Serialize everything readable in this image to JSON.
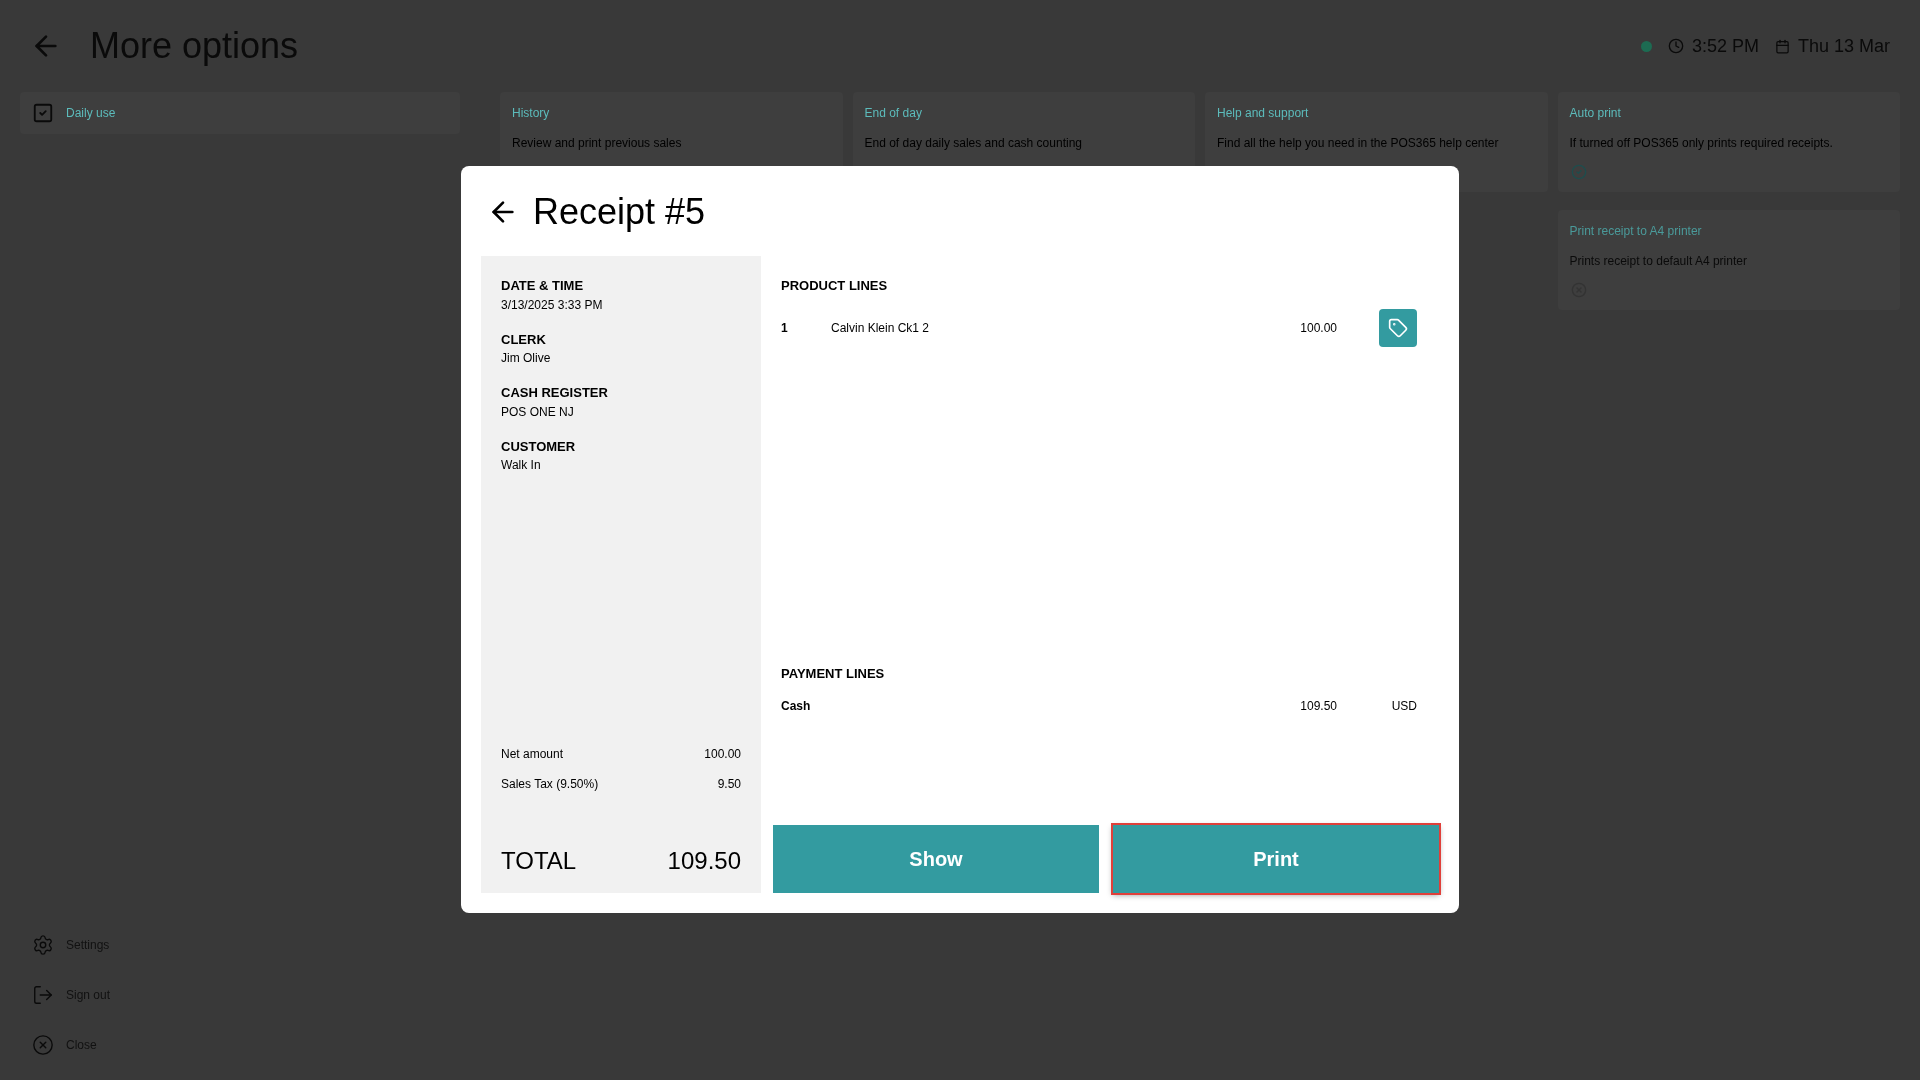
{
  "header": {
    "title": "More options",
    "status_online": true,
    "time": "3:52 PM",
    "date": "Thu 13 Mar"
  },
  "sidebar": {
    "items": [
      {
        "label": "Daily use",
        "selected": true
      }
    ],
    "footer": [
      {
        "kind": "settings",
        "label": "Settings"
      },
      {
        "kind": "signout",
        "label": "Sign out"
      },
      {
        "kind": "close",
        "label": "Close"
      }
    ]
  },
  "cards": [
    {
      "title": "History",
      "description": "Review and print previous sales"
    },
    {
      "title": "End of day",
      "description": "End of day daily sales and cash counting"
    },
    {
      "title": "Help and support",
      "description": "Find all the help you need in the POS365 help center"
    },
    {
      "title": "Auto print",
      "description": "If turned off POS365 only prints required receipts.",
      "on": true
    },
    {
      "title": "Print receipt to A4 printer",
      "description": "Prints receipt to default A4 printer",
      "on": false
    }
  ],
  "receipt": {
    "title": "Receipt #5",
    "details": [
      {
        "label": "DATE & TIME",
        "value": "3/13/2025 3:33 PM"
      },
      {
        "label": "CLERK",
        "value": "Jim Olive"
      },
      {
        "label": "CASH REGISTER",
        "value": "POS ONE NJ"
      },
      {
        "label": "CUSTOMER",
        "value": "Walk In"
      }
    ],
    "summary": [
      {
        "label": "Net amount",
        "value": "100.00"
      },
      {
        "label": "Sales Tax (9.50%)",
        "value": "9.50"
      }
    ],
    "total": {
      "label": "TOTAL",
      "value": "109.50"
    },
    "product_heading": "PRODUCT LINES",
    "products": [
      {
        "qty": "1",
        "name": "Calvin Klein Ck1 2",
        "price": "100.00"
      }
    ],
    "payment_heading": "PAYMENT LINES",
    "payments": [
      {
        "method": "Cash",
        "amount": "109.50",
        "currency": "USD"
      }
    ],
    "buttons": [
      {
        "label": "Show",
        "highlighted": false
      },
      {
        "label": "Print",
        "highlighted": true
      }
    ]
  }
}
